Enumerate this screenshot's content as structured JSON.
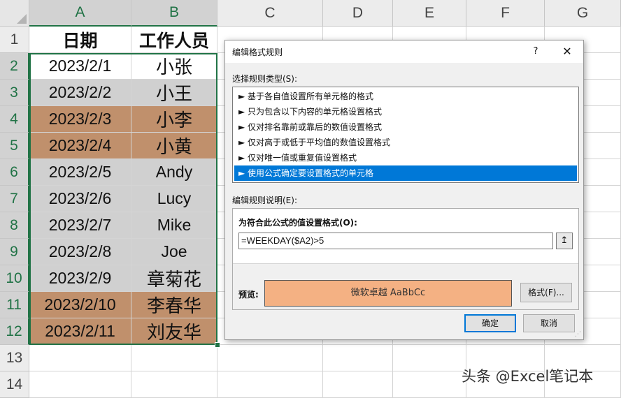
{
  "columns": [
    "A",
    "B",
    "C",
    "D",
    "E",
    "F",
    "G"
  ],
  "rows": [
    "1",
    "2",
    "3",
    "4",
    "5",
    "6",
    "7",
    "8",
    "9",
    "10",
    "11",
    "12",
    "13",
    "14"
  ],
  "sheet": {
    "header": {
      "date": "日期",
      "staff": "工作人员"
    },
    "records": [
      {
        "date": "2023/2/1",
        "name": "小张",
        "fill": "none"
      },
      {
        "date": "2023/2/2",
        "name": "小王",
        "fill": "gray"
      },
      {
        "date": "2023/2/3",
        "name": "小李",
        "fill": "brown"
      },
      {
        "date": "2023/2/4",
        "name": "小黄",
        "fill": "brown"
      },
      {
        "date": "2023/2/5",
        "name": "Andy",
        "fill": "gray"
      },
      {
        "date": "2023/2/6",
        "name": "Lucy",
        "fill": "gray"
      },
      {
        "date": "2023/2/7",
        "name": "Mike",
        "fill": "gray"
      },
      {
        "date": "2023/2/8",
        "name": "Joe",
        "fill": "gray"
      },
      {
        "date": "2023/2/9",
        "name": "章菊花",
        "fill": "gray"
      },
      {
        "date": "2023/2/10",
        "name": "李春华",
        "fill": "brown"
      },
      {
        "date": "2023/2/11",
        "name": "刘友华",
        "fill": "brown"
      }
    ]
  },
  "colors": {
    "gray": "#d0d0d0",
    "brown": "#c0906c",
    "preview": "#f4b183",
    "accent": "#0078d7",
    "excel_green": "#217346"
  },
  "dialog": {
    "title": "编辑格式规则",
    "help": "?",
    "close": "✕",
    "rule_type_label": "选择规则类型(S):",
    "rule_types": [
      "► 基于各自值设置所有单元格的格式",
      "► 只为包含以下内容的单元格设置格式",
      "► 仅对排名靠前或靠后的数值设置格式",
      "► 仅对高于或低于平均值的数值设置格式",
      "► 仅对唯一值或重复值设置格式",
      "► 使用公式确定要设置格式的单元格"
    ],
    "selected_rule_index": 5,
    "desc_label": "编辑规则说明(E):",
    "formula_label": "为符合此公式的值设置格式(O):",
    "formula_value": "=WEEKDAY($A2)>5",
    "collapse_icon": "↥",
    "preview_label": "预览:",
    "preview_text": "微软卓越  AaBbCc",
    "format_button": "格式(F)...",
    "ok": "确定",
    "cancel": "取消"
  },
  "watermark": "头条 @Excel笔记本"
}
